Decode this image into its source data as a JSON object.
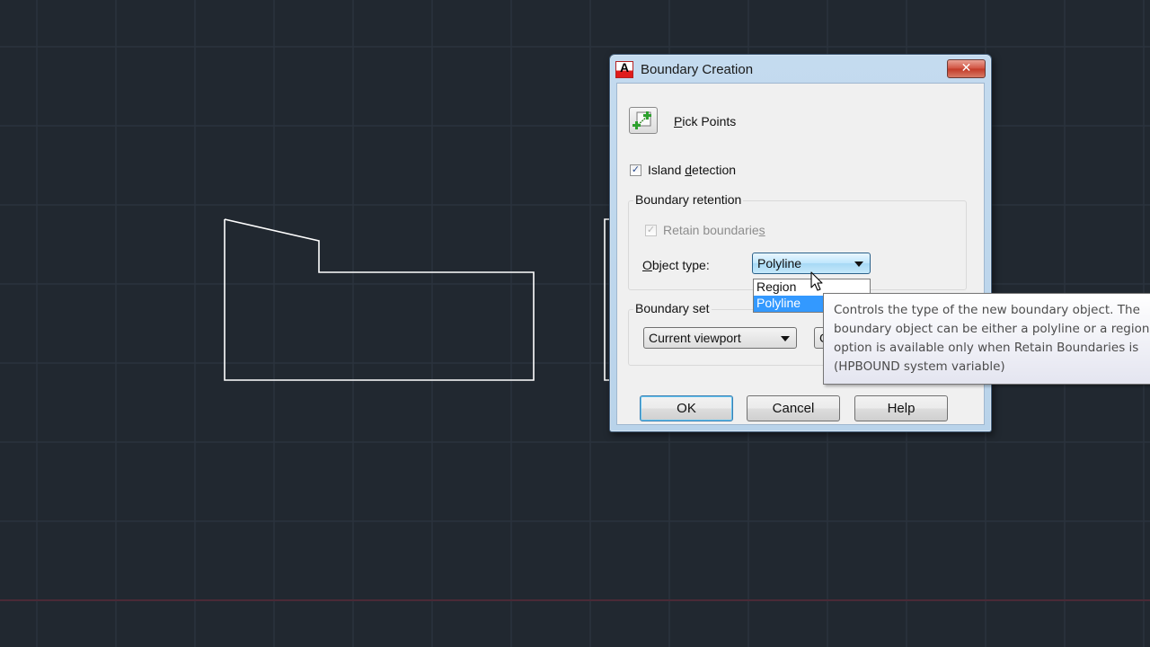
{
  "background": {
    "canvas_color": "#212830",
    "grid_color": "#2b333d",
    "axis_color": "#4a2a36",
    "shape_color": "#ffffff"
  },
  "dialog": {
    "title": "Boundary Creation",
    "app_icon": "autocad-icon",
    "close_icon": "close-icon",
    "pick_points": {
      "icon": "pick-points-icon",
      "label_prefix": "",
      "label_mnemonic": "P",
      "label_rest": "ick Points"
    },
    "island_detection": {
      "checked": true,
      "label_before": "Island ",
      "label_mnemonic": "d",
      "label_after": "etection"
    },
    "boundary_retention": {
      "group_label": "Boundary retention",
      "retain_boundaries": {
        "checked": true,
        "disabled": true,
        "label_before": "Retain boundarie",
        "label_mnemonic": "s"
      },
      "object_type": {
        "label_mnemonic": "O",
        "label_rest": "bject type:",
        "selected": "Polyline",
        "dropdown_open": true,
        "options": [
          "Region",
          "Polyline"
        ],
        "highlighted": "Polyline"
      }
    },
    "boundary_set": {
      "group_label": "Boundary set",
      "selected": "Current viewport",
      "hidden_button_partial": "C"
    },
    "buttons": {
      "ok": "OK",
      "cancel": "Cancel",
      "help": "Help"
    }
  },
  "tooltip": {
    "lines": [
      "Controls the type of the new boundary object. The",
      "boundary object can be either a polyline or a region.",
      "option is available only when Retain Boundaries is",
      "(HPBOUND system variable)"
    ]
  }
}
